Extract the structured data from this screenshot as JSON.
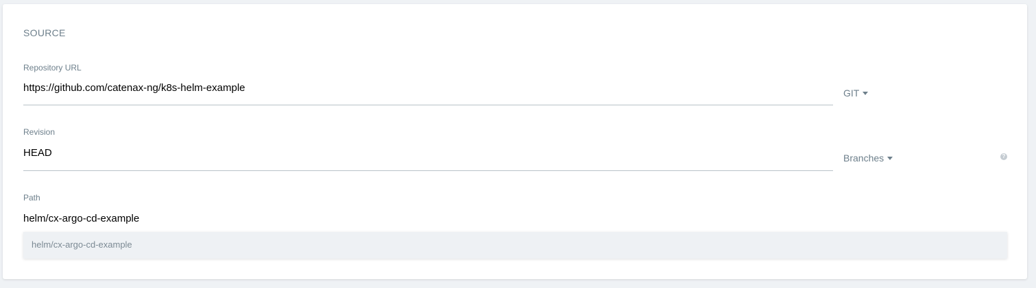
{
  "section": {
    "title": "SOURCE"
  },
  "repository": {
    "label": "Repository URL",
    "value": "https://github.com/catenax-ng/k8s-helm-example",
    "type_dropdown": "GIT"
  },
  "revision": {
    "label": "Revision",
    "value": "HEAD",
    "type_dropdown": "Branches",
    "help_icon": "question-circle-icon"
  },
  "path": {
    "label": "Path",
    "value": "helm/cx-argo-cd-example",
    "suggestions": [
      "helm/cx-argo-cd-example"
    ]
  },
  "colors": {
    "label": "#6d7f8b",
    "underline": "#b8c1c8",
    "background": "#eff2f5",
    "suggestion_bg": "#eef1f4"
  }
}
